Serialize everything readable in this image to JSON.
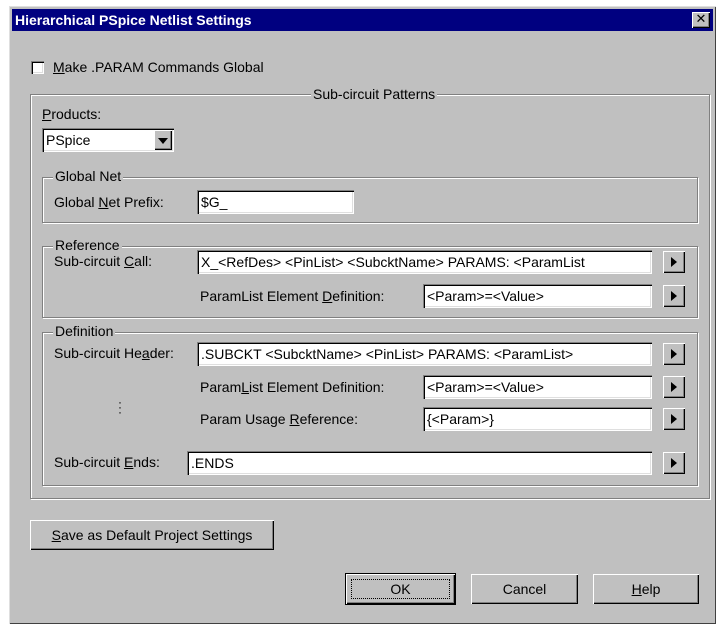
{
  "window": {
    "title": "Hierarchical PSpice Netlist Settings",
    "close_symbol": "✕"
  },
  "global_params": {
    "checkbox_checked": false,
    "label_mnemonic": "M",
    "label_rest": "ake .PARAM Commands Global"
  },
  "patterns": {
    "legend": "Sub-circuit Patterns",
    "products": {
      "label_mnemonic": "P",
      "label_rest": "roducts:",
      "selected": "PSpice"
    },
    "global_net": {
      "legend": "Global Net",
      "prefix_label_pre": "Global ",
      "prefix_label_mnemonic": "N",
      "prefix_label_post": "et Prefix:",
      "prefix_value": "$G_"
    },
    "reference": {
      "legend": "Reference",
      "call_label_pre": "Sub-circuit ",
      "call_label_mnemonic": "C",
      "call_label_post": "all:",
      "call_value": "X_<RefDes> <PinList> <SubcktName> PARAMS: <ParamList",
      "element_label_pre": "ParamList Element ",
      "element_label_mnemonic": "D",
      "element_label_post": "efinition:",
      "element_value": "<Param>=<Value>"
    },
    "definition": {
      "legend": "Definition",
      "header_label_pre": "Sub-circuit He",
      "header_label_mnemonic": "a",
      "header_label_post": "der:",
      "header_value": ".SUBCKT <SubcktName> <PinList> PARAMS: <ParamList>",
      "element_label_pre": "Param",
      "element_label_mnemonic": "L",
      "element_label_post": "ist Element Definition:",
      "element_value": "<Param>=<Value>",
      "usage_label_pre": "Param Usage ",
      "usage_label_mnemonic": "R",
      "usage_label_post": "eference:",
      "usage_value": "{<Param>}",
      "ends_label_pre": "Sub-circuit ",
      "ends_label_mnemonic": "E",
      "ends_label_post": "nds:",
      "ends_value": ".ENDS"
    }
  },
  "buttons": {
    "save_default_mnemonic": "S",
    "save_default_rest": "ave as Default Project Settings",
    "ok": "OK",
    "cancel": "Cancel",
    "help_mnemonic": "H",
    "help_rest": "elp"
  }
}
